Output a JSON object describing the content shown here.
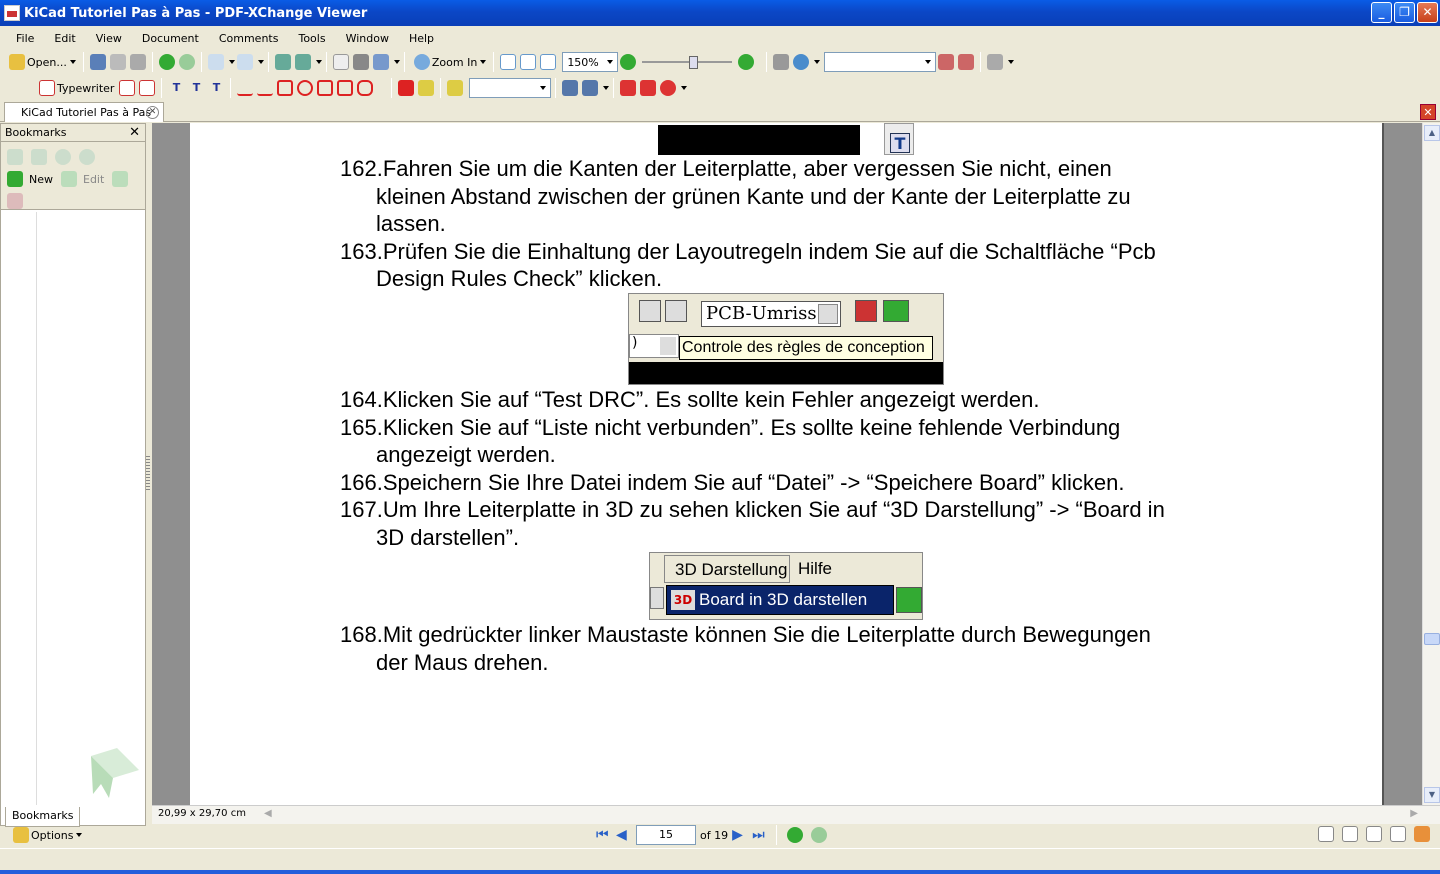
{
  "window": {
    "title": "KiCad Tutoriel Pas à Pas - PDF-XChange Viewer",
    "buttons": [
      "_",
      "❐",
      "✕"
    ]
  },
  "menu": [
    "File",
    "Edit",
    "View",
    "Document",
    "Comments",
    "Tools",
    "Window",
    "Help"
  ],
  "toolbar1": {
    "open_label": "Open...",
    "zoom_in_label": "Zoom In",
    "zoom_value": "150%"
  },
  "toolbar2": {
    "typewriter_label": "Typewriter"
  },
  "tab": {
    "label": "KiCad Tutoriel Pas à Pas"
  },
  "sidebar": {
    "header": "Bookmarks",
    "new_label": "New",
    "edit_label": "Edit",
    "tab_label": "Bookmarks"
  },
  "document": {
    "items": [
      {
        "num": "162.",
        "lines": [
          "Fahren Sie um die Kanten der Leiterplatte, aber vergessen Sie nicht, einen",
          "kleinen Abstand zwischen der grünen Kante und der Kante der Leiterplatte zu",
          "lassen."
        ]
      },
      {
        "num": "163.",
        "lines": [
          "Prüfen Sie die Einhaltung der Layoutregeln indem Sie auf die Schaltfläche  “Pcb",
          "Design Rules Check” klicken."
        ]
      },
      {
        "num": "164.",
        "lines": [
          "Klicken Sie auf “Test DRC”. Es sollte kein Fehler angezeigt werden."
        ]
      },
      {
        "num": "165.",
        "lines": [
          "Klicken Sie auf “Liste nicht verbunden”. Es sollte keine fehlende Verbindung",
          "angezeigt werden."
        ]
      },
      {
        "num": "166.",
        "lines": [
          "Speichern Sie Ihre Datei indem Sie auf “Datei” -> “Speichere Board” klicken."
        ]
      },
      {
        "num": "167.",
        "lines": [
          "Um Ihre Leiterplatte in 3D zu sehen klicken Sie auf “3D Darstellung” -> “Board in",
          "3D darstellen”."
        ]
      },
      {
        "num": "168.",
        "lines": [
          "Mit gedrückter linker Maustaste können Sie die Leiterplatte durch Bewegungen",
          "der Maus drehen."
        ]
      }
    ],
    "shot_drc": {
      "combo": "PCB-Umriss",
      "tooltip": "Controle des règles de conception",
      "combo2": ")"
    },
    "shot_3d": {
      "menu1": "3D Darstellung",
      "menu2": "Hilfe",
      "item": "Board in 3D darstellen",
      "badge": "3D"
    },
    "shot_top": {
      "glyph": "T"
    }
  },
  "status": {
    "page_size": "20,99 x 29,70 cm",
    "options_label": "Options",
    "page_current": "15",
    "page_total": "of 19"
  }
}
